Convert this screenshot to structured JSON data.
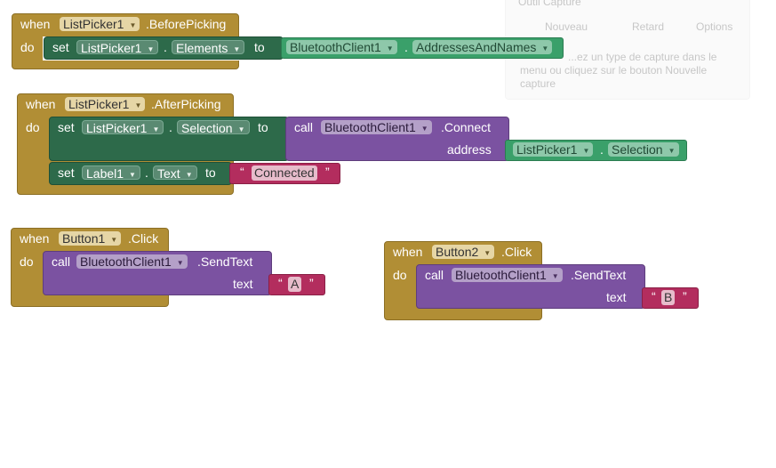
{
  "background_window": {
    "title": "Outil Capture",
    "buttons": [
      "Nouveau",
      "Retard",
      "Options"
    ],
    "hint_lines": [
      "...ez un type de capture dans le",
      "menu ou cliquez sur le bouton Nouvelle",
      "capture"
    ]
  },
  "keywords": {
    "when": "when",
    "do": "do",
    "set": "set",
    "to": "to",
    "call": "call",
    "dot": ".",
    "address": "address",
    "text": "text",
    "quote_open": "“",
    "quote_close": "”"
  },
  "block1": {
    "component": "ListPicker1",
    "event": ".BeforePicking",
    "set_component": "ListPicker1",
    "set_property": "Elements",
    "get_component": "BluetoothClient1",
    "get_property": "AddressesAndNames"
  },
  "block2": {
    "component": "ListPicker1",
    "event": ".AfterPicking",
    "set1_component": "ListPicker1",
    "set1_property": "Selection",
    "call_component": "BluetoothClient1",
    "call_method": ".Connect",
    "arg_component": "ListPicker1",
    "arg_property": "Selection",
    "set2_component": "Label1",
    "set2_property": "Text",
    "string_value": "Connected"
  },
  "block3": {
    "component": "Button1",
    "event": ".Click",
    "call_component": "BluetoothClient1",
    "call_method": ".SendText",
    "string_value": "A"
  },
  "block4": {
    "component": "Button2",
    "event": ".Click",
    "call_component": "BluetoothClient1",
    "call_method": ".SendText",
    "string_value": "B"
  },
  "dropdown_arrow": "▼",
  "colors": {
    "event": "#b18e35",
    "setter": "#2d6a4a",
    "getter": "#3aa06a",
    "procedure": "#7b52a1",
    "text": "#b32d5e"
  }
}
